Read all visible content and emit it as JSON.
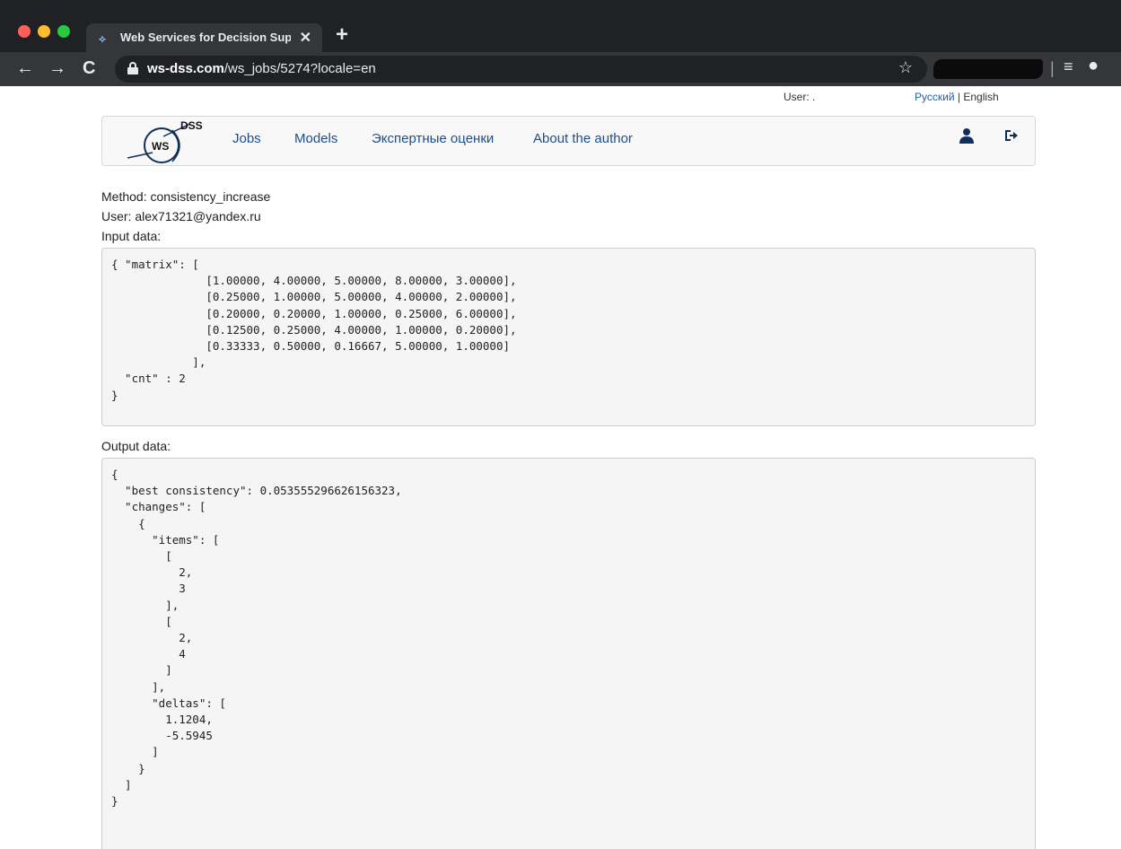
{
  "browser": {
    "tab_title": "Web Services for Decision Sup",
    "tab_close": "✕",
    "new_tab": "+",
    "url_domain": "ws-dss.com",
    "url_path": "/ws_jobs/5274?locale=en"
  },
  "icons": {
    "back": "←",
    "forward": "→",
    "reload": "C",
    "star": "☆",
    "reading_list": "≡",
    "profile": "●",
    "user": "👤",
    "logout": "⇥",
    "favicon": "⟡"
  },
  "top_bar": {
    "user_label": "User: .",
    "lang_ru": "Русский",
    "lang_separator": "|",
    "lang_en": "English"
  },
  "logo": {
    "dss": "DSS",
    "ws": "WS"
  },
  "nav": {
    "items": [
      {
        "label": "Jobs"
      },
      {
        "label": "Models"
      },
      {
        "label": "Экспертные оценки"
      },
      {
        "label": "About the author"
      }
    ]
  },
  "job": {
    "method": "Method: consistency_increase",
    "user": "User: alex71321@yandex.ru",
    "input_label": "Input data:",
    "input_code": "{ \"matrix\": [\n              [1.00000, 4.00000, 5.00000, 8.00000, 3.00000],\n              [0.25000, 1.00000, 5.00000, 4.00000, 2.00000],\n              [0.20000, 0.20000, 1.00000, 0.25000, 6.00000],\n              [0.12500, 0.25000, 4.00000, 1.00000, 0.20000],\n              [0.33333, 0.50000, 0.16667, 5.00000, 1.00000]\n            ],\n  \"cnt\" : 2\n}",
    "output_label": "Output data:",
    "output_code": "{\n  \"best consistency\": 0.053555296626156323,\n  \"changes\": [\n    {\n      \"items\": [\n        [\n          2,\n          3\n        ],\n        [\n          2,\n          4\n        ]\n      ],\n      \"deltas\": [\n        1.1204,\n        -5.5945\n      ]\n    }\n  ]\n}"
  }
}
